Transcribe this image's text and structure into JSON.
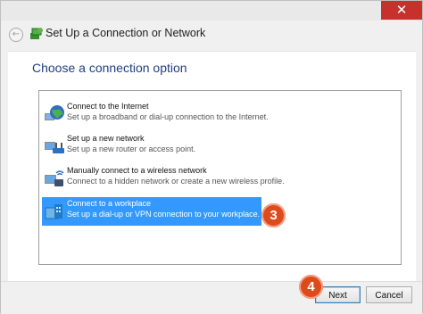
{
  "window": {
    "title": "Set Up a Connection or Network",
    "close_glyph": "✕",
    "back_glyph": "←"
  },
  "heading": "Choose a connection option",
  "options": [
    {
      "title": "Connect to the Internet",
      "description": "Set up a broadband or dial-up connection to the Internet.",
      "icon": "globe-network-icon",
      "selected": false
    },
    {
      "title": "Set up a new network",
      "description": "Set up a new router or access point.",
      "icon": "router-network-icon",
      "selected": false
    },
    {
      "title": "Manually connect to a wireless network",
      "description": "Connect to a hidden network or create a new wireless profile.",
      "icon": "wireless-network-icon",
      "selected": false
    },
    {
      "title": "Connect to a workplace",
      "description": "Set up a dial-up or VPN connection to your workplace.",
      "icon": "workplace-icon",
      "selected": true
    }
  ],
  "annotations": {
    "step3": "3",
    "step4": "4"
  },
  "buttons": {
    "next": "Next",
    "cancel": "Cancel"
  },
  "colors": {
    "selection": "#3399ff",
    "heading": "#1f3f82",
    "badge": "#dd4a1c",
    "close": "#c7312b"
  }
}
